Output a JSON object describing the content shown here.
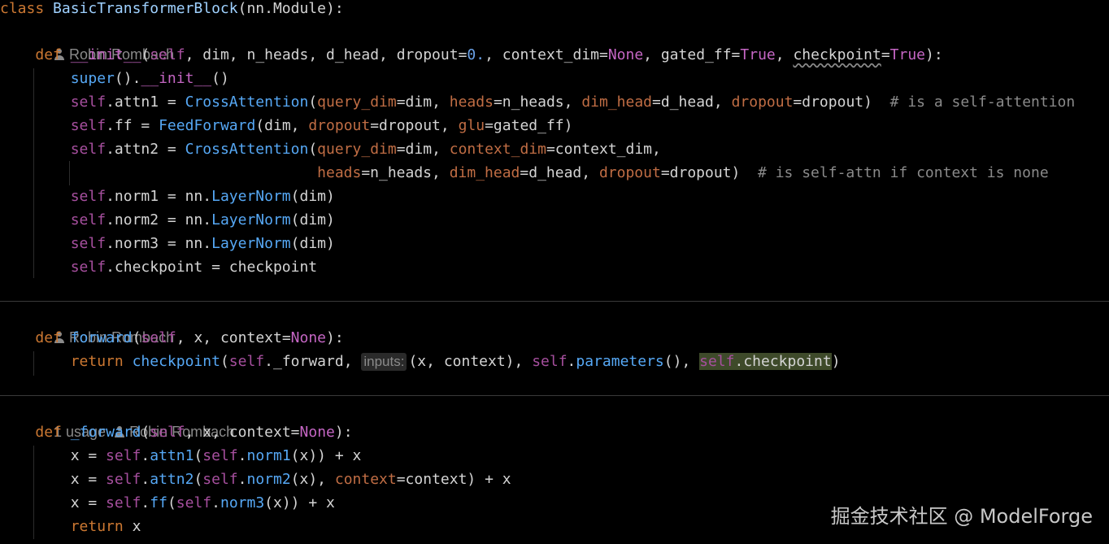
{
  "colors": {
    "background": "#000000",
    "default": "#d4d4d4",
    "keyword": "#cc7832",
    "self": "#a64f9e",
    "classname": "#9fd1ff",
    "function": "#56a8f5",
    "dunder": "#c566c4",
    "param": "#d56b6b",
    "constant": "#c566c4",
    "number": "#6aa1e6",
    "comment": "#8a8a8a",
    "named_arg": "#c06d44",
    "hint": "#8a8a8a"
  },
  "hints": {
    "author": "Robin Rombach",
    "usage": "1 usage",
    "inlay_inputs": "inputs:"
  },
  "code_lines": [
    {
      "tokens": [
        [
          "class",
          "kw"
        ],
        [
          " ",
          "d"
        ],
        [
          "BasicTransformerBlock",
          "cls"
        ],
        [
          "(nn.Module):",
          "d"
        ]
      ]
    },
    {
      "tokens": [
        [
          "    ",
          "d"
        ],
        [
          "def",
          "kw"
        ],
        [
          " ",
          "d"
        ],
        [
          "__init__",
          "dun"
        ],
        [
          "(",
          "d"
        ],
        [
          "self",
          "self"
        ],
        [
          ", dim, n_heads, d_head, dropout=",
          "d"
        ],
        [
          "0.",
          "num"
        ],
        [
          ", context_dim=",
          "d"
        ],
        [
          "None",
          "const"
        ],
        [
          ", gated_ff=",
          "d"
        ],
        [
          "True",
          "const"
        ],
        [
          ", ",
          "d"
        ],
        [
          "checkpoint",
          "sq"
        ],
        [
          "=",
          "d"
        ],
        [
          "True",
          "const"
        ],
        [
          "):",
          "d"
        ]
      ]
    },
    {
      "tokens": [
        [
          "        ",
          "d"
        ],
        [
          "super",
          "fn"
        ],
        [
          "().",
          "d"
        ],
        [
          "__init__",
          "dun"
        ],
        [
          "()",
          "d"
        ]
      ]
    },
    {
      "tokens": [
        [
          "        ",
          "d"
        ],
        [
          "self",
          "self"
        ],
        [
          ".attn1 = ",
          "d"
        ],
        [
          "CrossAttention",
          "fn"
        ],
        [
          "(",
          "d"
        ],
        [
          "query_dim",
          "na"
        ],
        [
          "=dim, ",
          "d"
        ],
        [
          "heads",
          "na"
        ],
        [
          "=n_heads, ",
          "d"
        ],
        [
          "dim_head",
          "na"
        ],
        [
          "=d_head, ",
          "d"
        ],
        [
          "dropout",
          "na"
        ],
        [
          "=dropout)  ",
          "d"
        ],
        [
          "# is a self-attention",
          "cm"
        ]
      ]
    },
    {
      "tokens": [
        [
          "        ",
          "d"
        ],
        [
          "self",
          "self"
        ],
        [
          ".ff = ",
          "d"
        ],
        [
          "FeedForward",
          "fn"
        ],
        [
          "(dim, ",
          "d"
        ],
        [
          "dropout",
          "na"
        ],
        [
          "=dropout, ",
          "d"
        ],
        [
          "glu",
          "na"
        ],
        [
          "=gated_ff)",
          "d"
        ]
      ]
    },
    {
      "tokens": [
        [
          "        ",
          "d"
        ],
        [
          "self",
          "self"
        ],
        [
          ".attn2 = ",
          "d"
        ],
        [
          "CrossAttention",
          "fn"
        ],
        [
          "(",
          "d"
        ],
        [
          "query_dim",
          "na"
        ],
        [
          "=dim, ",
          "d"
        ],
        [
          "context_dim",
          "na"
        ],
        [
          "=context_dim,",
          "d"
        ]
      ]
    },
    {
      "tokens": [
        [
          "                                    ",
          "d"
        ],
        [
          "heads",
          "na"
        ],
        [
          "=n_heads, ",
          "d"
        ],
        [
          "dim_head",
          "na"
        ],
        [
          "=d_head, ",
          "d"
        ],
        [
          "dropout",
          "na"
        ],
        [
          "=dropout)  ",
          "d"
        ],
        [
          "# is self-attn if context is none",
          "cm"
        ]
      ]
    },
    {
      "tokens": [
        [
          "        ",
          "d"
        ],
        [
          "self",
          "self"
        ],
        [
          ".norm1 = nn.",
          "d"
        ],
        [
          "LayerNorm",
          "fn"
        ],
        [
          "(dim)",
          "d"
        ]
      ]
    },
    {
      "tokens": [
        [
          "        ",
          "d"
        ],
        [
          "self",
          "self"
        ],
        [
          ".norm2 = nn.",
          "d"
        ],
        [
          "LayerNorm",
          "fn"
        ],
        [
          "(dim)",
          "d"
        ]
      ]
    },
    {
      "tokens": [
        [
          "        ",
          "d"
        ],
        [
          "self",
          "self"
        ],
        [
          ".norm3 = nn.",
          "d"
        ],
        [
          "LayerNorm",
          "fn"
        ],
        [
          "(dim)",
          "d"
        ]
      ]
    },
    {
      "tokens": [
        [
          "        ",
          "d"
        ],
        [
          "self",
          "self"
        ],
        [
          ".checkpoint = checkpoint",
          "d"
        ]
      ]
    },
    {
      "tokens": [
        [
          "    ",
          "d"
        ],
        [
          "def",
          "kw"
        ],
        [
          " ",
          "d"
        ],
        [
          "forward",
          "fn"
        ],
        [
          "(",
          "d"
        ],
        [
          "self",
          "self"
        ],
        [
          ", x, context=",
          "d"
        ],
        [
          "None",
          "const"
        ],
        [
          "):",
          "d"
        ]
      ]
    },
    {
      "tokens": [
        [
          "        ",
          "d"
        ],
        [
          "return",
          "kw"
        ],
        [
          " ",
          "d"
        ],
        [
          "checkpoint",
          "fn"
        ],
        [
          "(",
          "d"
        ],
        [
          "self",
          "self"
        ],
        [
          "._forward, ",
          "d"
        ],
        [
          "inputs:",
          "inlay"
        ],
        [
          "(x, context), ",
          "d"
        ],
        [
          "self",
          "self"
        ],
        [
          ".",
          "d"
        ],
        [
          "parameters",
          "fn"
        ],
        [
          "(), ",
          "d"
        ],
        [
          "self",
          "hlself"
        ],
        [
          ".checkpoint",
          "hl"
        ],
        [
          ")",
          "d"
        ]
      ]
    },
    {
      "tokens": [
        [
          "    ",
          "d"
        ],
        [
          "def",
          "kw"
        ],
        [
          " ",
          "d"
        ],
        [
          "_forward",
          "fn"
        ],
        [
          "(",
          "d"
        ],
        [
          "self",
          "self"
        ],
        [
          ", x, context=",
          "d"
        ],
        [
          "None",
          "const"
        ],
        [
          "):",
          "d"
        ]
      ]
    },
    {
      "tokens": [
        [
          "        x = ",
          "d"
        ],
        [
          "self",
          "self"
        ],
        [
          ".",
          "d"
        ],
        [
          "attn1",
          "fn"
        ],
        [
          "(",
          "d"
        ],
        [
          "self",
          "self"
        ],
        [
          ".",
          "d"
        ],
        [
          "norm1",
          "fn"
        ],
        [
          "(x)) + x",
          "d"
        ]
      ]
    },
    {
      "tokens": [
        [
          "        x = ",
          "d"
        ],
        [
          "self",
          "self"
        ],
        [
          ".",
          "d"
        ],
        [
          "attn2",
          "fn"
        ],
        [
          "(",
          "d"
        ],
        [
          "self",
          "self"
        ],
        [
          ".",
          "d"
        ],
        [
          "norm2",
          "fn"
        ],
        [
          "(x), ",
          "d"
        ],
        [
          "context",
          "na"
        ],
        [
          "=context) + x",
          "d"
        ]
      ]
    },
    {
      "tokens": [
        [
          "        x = ",
          "d"
        ],
        [
          "self",
          "self"
        ],
        [
          ".",
          "d"
        ],
        [
          "ff",
          "fn"
        ],
        [
          "(",
          "d"
        ],
        [
          "self",
          "self"
        ],
        [
          ".",
          "d"
        ],
        [
          "norm3",
          "fn"
        ],
        [
          "(x)) + x",
          "d"
        ]
      ]
    },
    {
      "tokens": [
        [
          "        ",
          "d"
        ],
        [
          "return",
          "kw"
        ],
        [
          " x",
          "d"
        ]
      ]
    }
  ],
  "watermark": "掘金技术社区 @ ModelForge"
}
